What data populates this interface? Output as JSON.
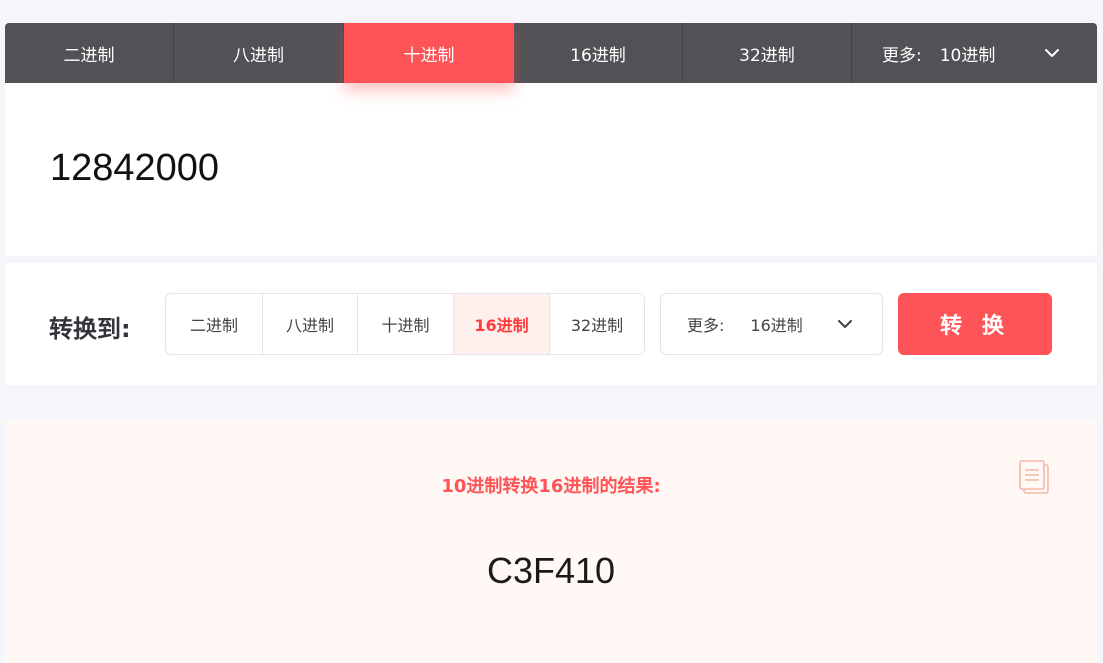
{
  "source_tabs": {
    "items": [
      "二进制",
      "八进制",
      "十进制",
      "16进制",
      "32进制"
    ],
    "active_index": 2,
    "more_label": "更多:",
    "more_value": "10进制"
  },
  "input": {
    "value": "12842000"
  },
  "convert": {
    "label": "转换到:",
    "targets": [
      "二进制",
      "八进制",
      "十进制",
      "16进制",
      "32进制"
    ],
    "active_index": 3,
    "more_label": "更多:",
    "more_value": "16进制",
    "button_label": "转 换"
  },
  "result": {
    "title": "10进制转换16进制的结果:",
    "value": "C3F410"
  },
  "colors": {
    "accent": "#ff5457",
    "tabbar": "#525256",
    "result_bg": "#fff8f5"
  },
  "icons": {
    "dropdown": "chevron-down-icon",
    "copy": "copy-icon"
  }
}
